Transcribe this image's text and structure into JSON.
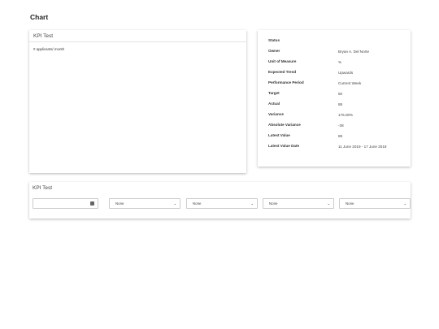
{
  "page": {
    "title": "Chart"
  },
  "chart_panel": {
    "title": "KPI Test",
    "series_label": "# applicants/ month"
  },
  "details": [
    {
      "label": "Status",
      "value": ""
    },
    {
      "label": "Owner",
      "value": "Bryan A. Del Norte"
    },
    {
      "label": "Unit of Measure",
      "value": "%"
    },
    {
      "label": "Expected Trend",
      "value": "Upwards"
    },
    {
      "label": "Performance Period",
      "value": "Current Week"
    },
    {
      "label": "Target",
      "value": "50"
    },
    {
      "label": "Actual",
      "value": "88"
    },
    {
      "label": "Variance",
      "value": "176.00%"
    },
    {
      "label": "Absolute Variance",
      "value": "-38"
    },
    {
      "label": "Latest Value",
      "value": "88"
    },
    {
      "label": "Latest Value Date",
      "value": "11 June 2019 - 17 June 2019"
    }
  ],
  "filter_panel": {
    "title": "KPI Test",
    "date_value": "",
    "selects": [
      "None",
      "None",
      "None",
      "None"
    ]
  }
}
